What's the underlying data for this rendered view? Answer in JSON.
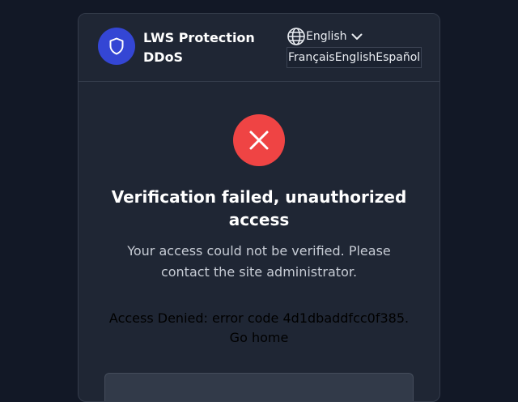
{
  "brand": {
    "name": "LWS Protection DDoS",
    "logo_icon": "shield-icon",
    "logo_color": "#3446d4"
  },
  "language": {
    "current": "English",
    "options": [
      "Français",
      "English",
      "Español"
    ]
  },
  "status": {
    "icon": "close-icon",
    "color": "#ef4444",
    "title": "Verification failed, unauthorized access",
    "description": "Your access could not be verified. Please contact the site administrator."
  },
  "denied": {
    "message": "Access Denied: error code 4d1dbaddfcc0f385.",
    "home_link": "Go home"
  }
}
